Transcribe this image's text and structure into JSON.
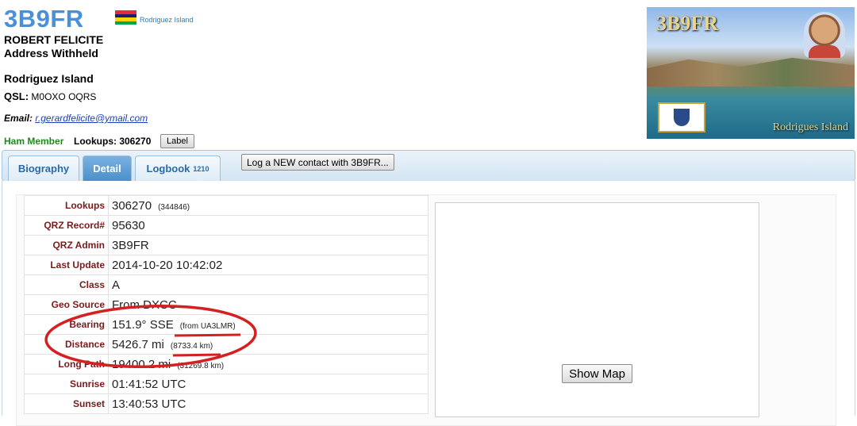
{
  "header": {
    "callsign": "3B9FR",
    "flag_country": "Rodriguez Island",
    "name": "ROBERT FELICITE",
    "address": "Address Withheld",
    "country": "Rodriguez Island",
    "qsl_label": "QSL:",
    "qsl_value": "M0OXO OQRS",
    "email_label": "Email:",
    "email_value": "r.gerardfelicite@ymail.com",
    "member": "Ham Member",
    "lookups": "Lookups: 306270",
    "label_button": "Label"
  },
  "photo": {
    "title": "3B9FR",
    "caption": "Rodrigues Island"
  },
  "tabs": [
    {
      "label": "Biography",
      "active": false
    },
    {
      "label": "Detail",
      "active": true
    },
    {
      "label": "Logbook",
      "count": "1210",
      "active": false
    }
  ],
  "new_contact_button": "Log a NEW contact with 3B9FR...",
  "detail_rows": [
    {
      "key": "Lookups",
      "value": "306270",
      "extra": "(344846)"
    },
    {
      "key": "QRZ Record#",
      "value": "95630",
      "extra": ""
    },
    {
      "key": "QRZ Admin",
      "value": "3B9FR",
      "extra": ""
    },
    {
      "key": "Last Update",
      "value": "2014-10-20 10:42:02",
      "extra": ""
    },
    {
      "key": "Class",
      "value": "A",
      "extra": ""
    },
    {
      "key": "Geo Source",
      "value": "From DXCC",
      "extra": ""
    },
    {
      "key": "Bearing",
      "value": "151.9° SSE",
      "extra": "(from UA3LMR)"
    },
    {
      "key": "Distance",
      "value": "5426.7 mi",
      "extra": "(8733.4 km)"
    },
    {
      "key": "Long Path",
      "value": "19400.2 mi",
      "extra": "(31269.8 km)"
    },
    {
      "key": "Sunrise",
      "value": "01:41:52 UTC",
      "extra": ""
    },
    {
      "key": "Sunset",
      "value": "13:40:53 UTC",
      "extra": ""
    }
  ],
  "show_map_button": "Show Map",
  "colors": {
    "accent": "#4a90d9",
    "annotation": "#d42020",
    "key_text": "#7a1a1a"
  }
}
